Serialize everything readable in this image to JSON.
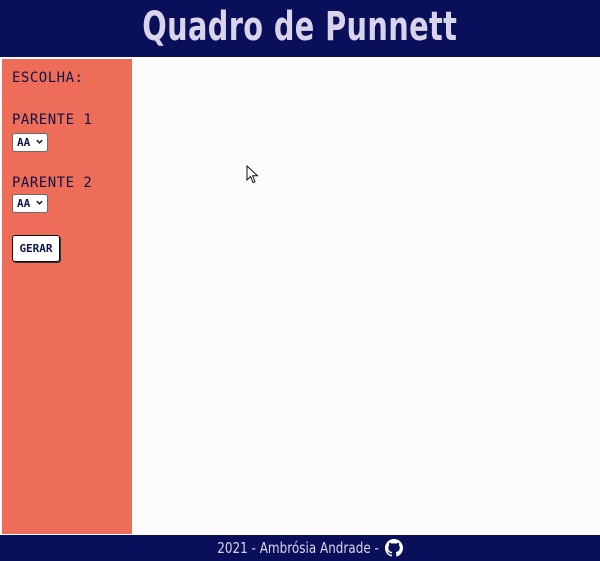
{
  "header": {
    "title": "Quadro de Punnett"
  },
  "sidebar": {
    "choose_label": "ESCOLHA:",
    "parent1": {
      "label": "PARENTE 1",
      "selected": "AA"
    },
    "parent2": {
      "label": "PARENTE 2",
      "selected": "AA"
    },
    "generate_label": "GERAR"
  },
  "footer": {
    "credit": "2021 - Ambrósia Andrade -",
    "icon": "github-icon"
  },
  "colors": {
    "header_bg": "#0a0f5a",
    "sidebar_bg": "#ee6d58",
    "main_bg": "#fdfbfd",
    "title_text": "#d9d4ea"
  }
}
